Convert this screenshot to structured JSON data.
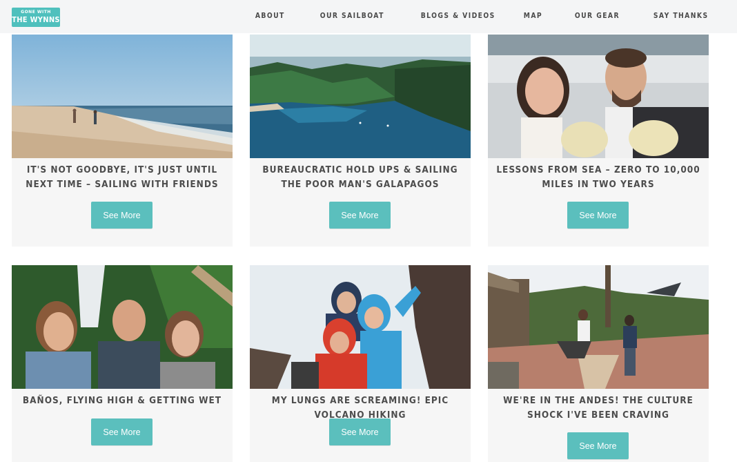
{
  "site": {
    "logo_small": "GONE WITH",
    "logo_big": "THE WYNNS"
  },
  "nav": [
    "ABOUT",
    "OUR SAILBOAT",
    "BLOGS & VIDEOS",
    "MAP",
    "OUR GEAR",
    "SAY THANKS"
  ],
  "posts": [
    {
      "title": "It's Not Goodbye, It's Just Until Next Time – Sailing With Friends",
      "button": "See More"
    },
    {
      "title": "Bureaucratic Hold Ups & Sailing The Poor Man's Galapagos",
      "button": "See More"
    },
    {
      "title": "Lessons From Sea – Zero To 10,000 Miles In Two Years",
      "button": "See More"
    },
    {
      "title": "Baños, Flying High & Getting Wet",
      "button": "See More"
    },
    {
      "title": "My Lungs Are Screaming! Epic Volcano Hiking",
      "button": "See More"
    },
    {
      "title": "We're In The Andes! The Culture Shock I've Been Craving",
      "button": "See More"
    }
  ],
  "colors": {
    "accent": "#5bbfbd",
    "header_bg": "#f4f5f6",
    "card_bg": "#f6f6f6",
    "title_text": "#4c4c4c"
  }
}
